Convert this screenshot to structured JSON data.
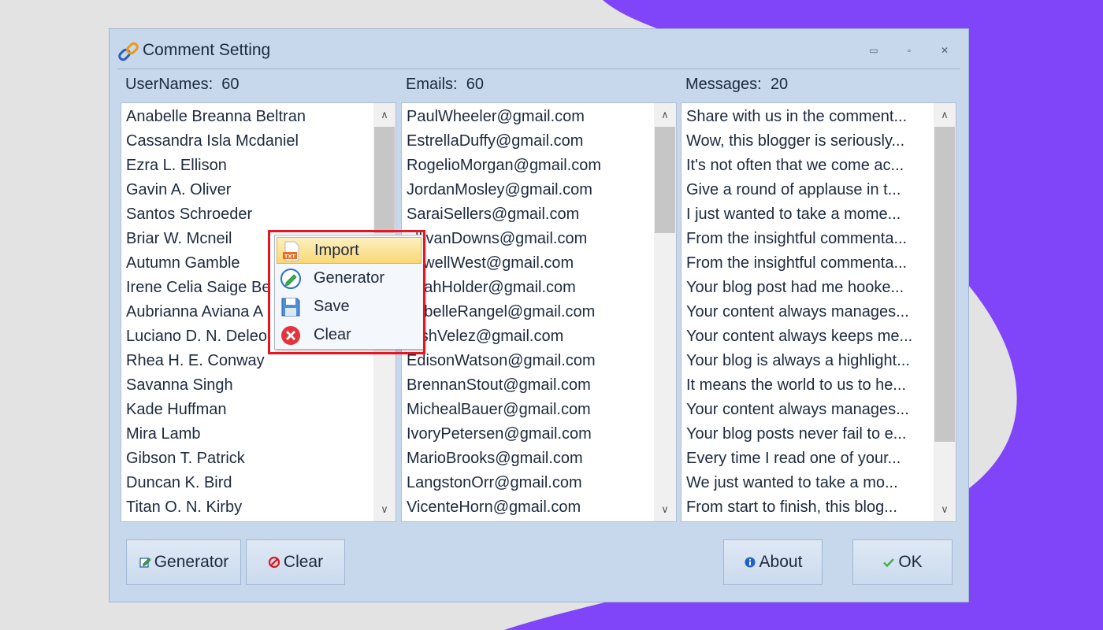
{
  "window": {
    "title": "Comment Setting",
    "controls": {
      "minimize": "▭",
      "maximize": "▫",
      "close": "✕"
    }
  },
  "columns": {
    "usernames": {
      "label": "UserNames:",
      "count": "60",
      "items": [
        "Anabelle Breanna Beltran",
        "Cassandra Isla Mcdaniel",
        "Ezra L. Ellison",
        "Gavin A. Oliver",
        "Santos Schroeder",
        "Briar W. Mcneil",
        "Autumn Gamble",
        "Irene Celia Saige Be",
        "Aubrianna Aviana A",
        "Luciano D. N. Deleo",
        "Rhea H. E. Conway",
        "Savanna Singh",
        "Kade Huffman",
        "Mira Lamb",
        "Gibson T. Patrick",
        "Duncan K. Bird",
        "Titan O. N. Kirby"
      ]
    },
    "emails": {
      "label": "Emails:",
      "count": "60",
      "items": [
        "PaulWheeler@gmail.com",
        "EstrellaDuffy@gmail.com",
        "RogelioMorgan@gmail.com",
        "JordanMosley@gmail.com",
        "SaraiSellers@gmail.com",
        "ullivanDowns@gmail.com",
        "axwellWest@gmail.com",
        "oriahHolder@gmail.com",
        "nabelleRangel@gmail.com",
        "rushVelez@gmail.com",
        "EdisonWatson@gmail.com",
        "BrennanStout@gmail.com",
        "MichealBauer@gmail.com",
        "IvoryPetersen@gmail.com",
        "MarioBrooks@gmail.com",
        "LangstonOrr@gmail.com",
        "VicenteHorn@gmail.com"
      ]
    },
    "messages": {
      "label": "Messages:",
      "count": "20",
      "items": [
        "Share with us in the comment...",
        "Wow, this blogger is seriously...",
        "It's not often that we come ac...",
        "Give a round of applause  in t...",
        "I just wanted to take a mome...",
        "From the insightful commenta...",
        "From the insightful commenta...",
        "Your blog post had me hooke...",
        "Your content always manages...",
        "Your content always keeps me...",
        "Your blog is always a highlight...",
        "It means the world to us to he...",
        "Your content always manages...",
        "Your blog posts never fail to e...",
        "Every time I read one of your...",
        "We just wanted to take a mo...",
        "From start to finish, this blog..."
      ]
    }
  },
  "scroll": {
    "up_glyph": "∧",
    "down_glyph": "∨"
  },
  "context_menu": {
    "items": [
      {
        "label": "Import",
        "icon": "txt-file-icon",
        "highlighted": true
      },
      {
        "label": "Generator",
        "icon": "edit-pen-icon",
        "highlighted": false
      },
      {
        "label": "Save",
        "icon": "floppy-disk-icon",
        "highlighted": false
      },
      {
        "label": "Clear",
        "icon": "red-x-icon",
        "highlighted": false
      }
    ]
  },
  "buttons": {
    "generator": "Generator",
    "clear": "Clear",
    "about": "About",
    "ok": "OK"
  },
  "colors": {
    "window_bg": "#c7d8ec",
    "accent_purple": "#8045f8",
    "highlight_red": "#e8141e",
    "menu_highlight": "#f9d874"
  }
}
